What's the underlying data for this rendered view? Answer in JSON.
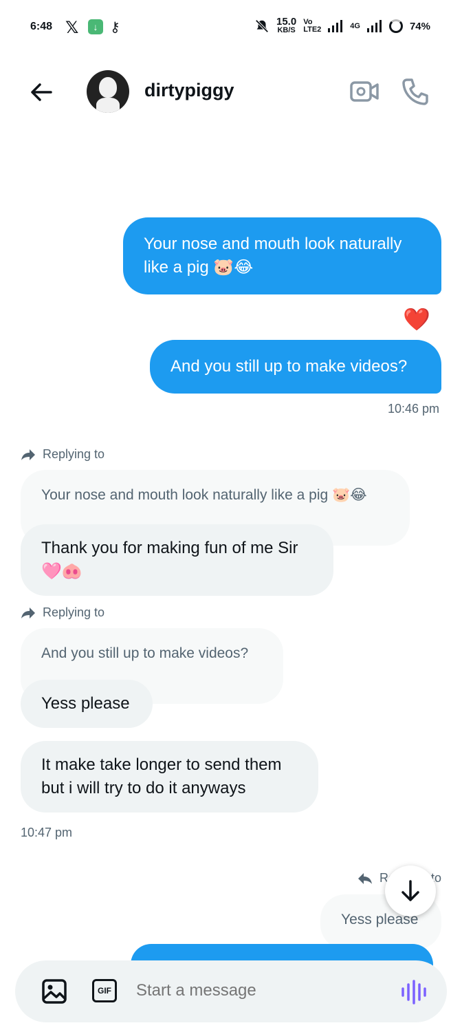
{
  "status_bar": {
    "time": "6:48",
    "x_logo": "𝕏",
    "download_glyph": "↓",
    "key_glyph": "⚷",
    "speed_value": "15.0",
    "speed_unit": "KB/S",
    "volte_top": "Vo",
    "volte_bottom": "LTE2",
    "network": "4G",
    "battery": "74%"
  },
  "header": {
    "contact_name": "dirtypiggy"
  },
  "messages": {
    "out1": "Your nose and mouth look naturally like a pig 🐷😂",
    "reaction": "❤️",
    "out2": "And you still up to make videos?",
    "time1": "10:46 pm",
    "reply1_label": "Replying to",
    "reply1_quote": "Your nose and mouth look naturally like a pig 🐷😂",
    "in1": "Thank you for making fun of me Sir 🩷🐽",
    "reply2_label": "Replying to",
    "reply2_quote": "And you still up to make videos?",
    "in2": "Yess please",
    "in3": "It make take longer to send them but i will try to do it anyways",
    "time2": "10:47 pm",
    "reply3_label": "Replying to",
    "reply3_quote": "Yess please"
  },
  "composer": {
    "gif_label": "GIF",
    "placeholder": "Start a message"
  },
  "colors": {
    "accent": "#1d9bf0",
    "bubble_in": "#eff3f4",
    "voice": "#7b61ff"
  }
}
